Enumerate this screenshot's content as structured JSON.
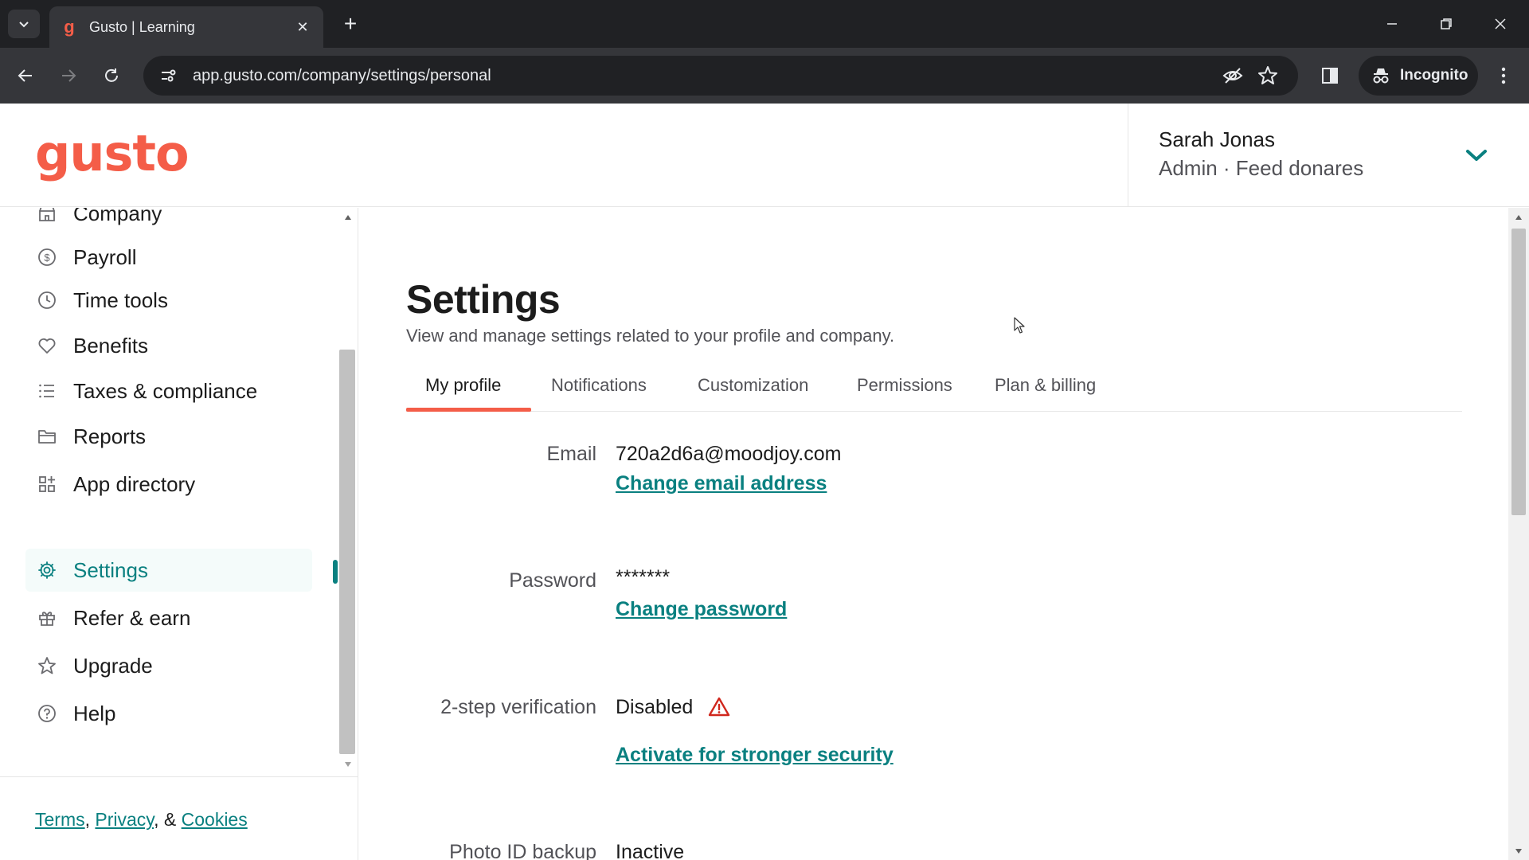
{
  "browser": {
    "tab_title": "Gusto | Learning",
    "favicon_letter": "g",
    "url": "app.gusto.com/company/settings/personal",
    "incognito_label": "Incognito"
  },
  "header": {
    "logo_text": "gusto",
    "user_name": "Sarah Jonas",
    "user_role": "Admin · Feed donares"
  },
  "sidebar": {
    "items": [
      {
        "label": "Company",
        "icon": "building-icon"
      },
      {
        "label": "Payroll",
        "icon": "dollar-circle-icon"
      },
      {
        "label": "Time tools",
        "icon": "clock-icon"
      },
      {
        "label": "Benefits",
        "icon": "heart-icon"
      },
      {
        "label": "Taxes & compliance",
        "icon": "list-icon"
      },
      {
        "label": "Reports",
        "icon": "folder-icon"
      },
      {
        "label": "App directory",
        "icon": "apps-grid-icon"
      },
      {
        "label": "Settings",
        "icon": "gear-icon",
        "active": true
      },
      {
        "label": "Refer & earn",
        "icon": "gift-icon"
      },
      {
        "label": "Upgrade",
        "icon": "star-icon"
      },
      {
        "label": "Help",
        "icon": "help-circle-icon"
      }
    ],
    "footer": {
      "terms": "Terms",
      "comma": ",",
      "privacy": "Privacy",
      "amp": ", &",
      "cookies": "Cookies"
    }
  },
  "main": {
    "title": "Settings",
    "subtitle": "View and manage settings related to your profile and company.",
    "tabs": [
      {
        "label": "My profile",
        "active": true
      },
      {
        "label": "Notifications"
      },
      {
        "label": "Customization"
      },
      {
        "label": "Permissions"
      },
      {
        "label": "Plan & billing"
      }
    ],
    "fields": {
      "email_label": "Email",
      "email_value": "720a2d6a@moodjoy.com",
      "email_link": "Change email address",
      "password_label": "Password",
      "password_value": "*******",
      "password_link": "Change password",
      "twostep_label": "2-step verification",
      "twostep_value": "Disabled",
      "twostep_link": "Activate for stronger security",
      "photo_label": "Photo ID backup",
      "photo_value": "Inactive"
    }
  },
  "colors": {
    "brand": "#f45d48",
    "link": "#0a8080",
    "warning": "#d0271d"
  }
}
